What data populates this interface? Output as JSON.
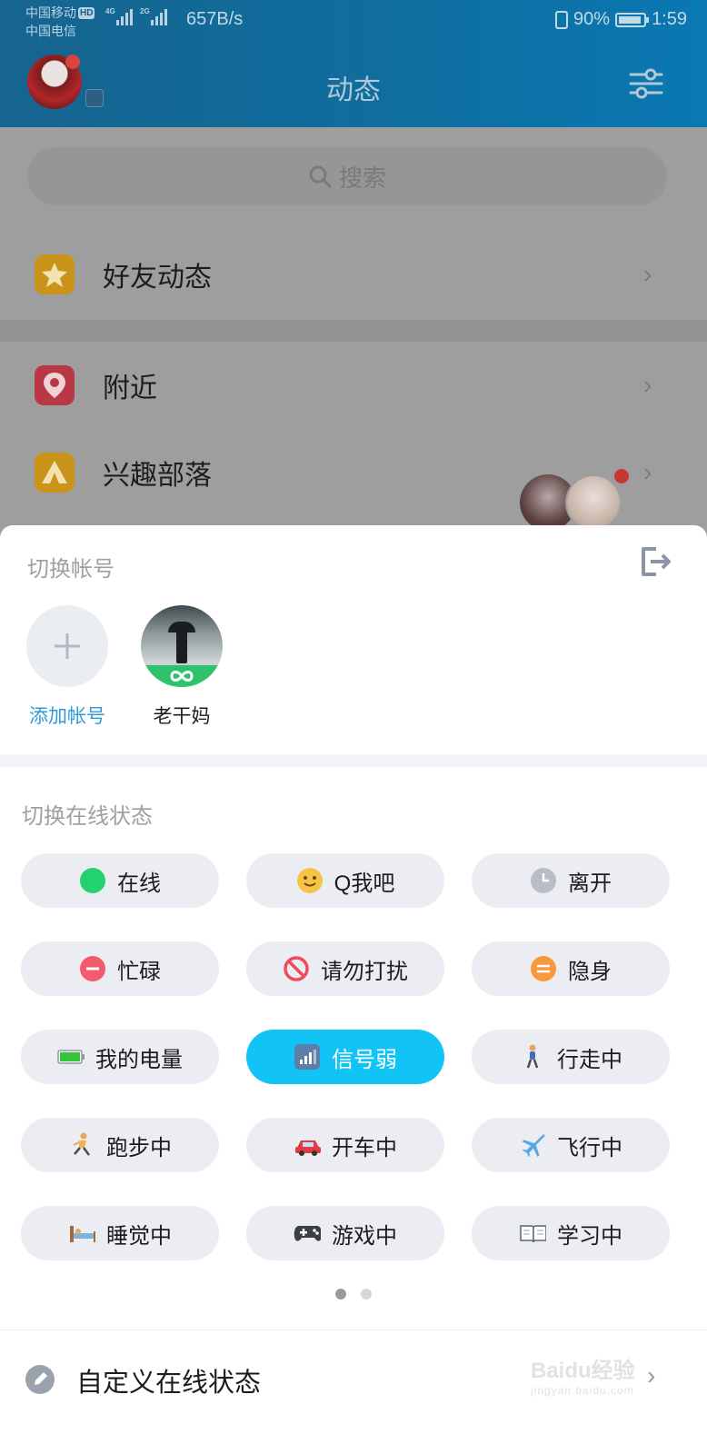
{
  "status_bar": {
    "carrier1": "中国移动",
    "carrier1_badge": "HD",
    "carrier2": "中国电信",
    "sim1_tag": "4G",
    "sim2_tag": "2G",
    "net_speed": "657B/s",
    "battery": "90%",
    "time": "1:59"
  },
  "header": {
    "title": "动态"
  },
  "search": {
    "placeholder": "搜索"
  },
  "feed_rows": [
    {
      "label": "好友动态",
      "icon": "star-icon",
      "color": "#d8a21a"
    },
    {
      "label": "附近",
      "icon": "location-pin-icon",
      "color": "#c9404d"
    },
    {
      "label": "兴趣部落",
      "icon": "tent-icon",
      "color": "#d8a21a"
    }
  ],
  "switch_account": {
    "title": "切换帐号",
    "accounts": [
      {
        "name": "添加帐号",
        "type": "add"
      },
      {
        "name": "老干妈",
        "type": "avatar"
      }
    ]
  },
  "online_status": {
    "title": "切换在线状态",
    "options": [
      {
        "label": "在线",
        "icon": "green-dot-icon",
        "active": false
      },
      {
        "label": "Q我吧",
        "icon": "smiley-icon",
        "active": false
      },
      {
        "label": "离开",
        "icon": "clock-icon",
        "active": false
      },
      {
        "label": "忙碌",
        "icon": "minus-circle-icon",
        "active": false
      },
      {
        "label": "请勿打扰",
        "icon": "no-entry-icon",
        "active": false
      },
      {
        "label": "隐身",
        "icon": "equals-circle-icon",
        "active": false
      },
      {
        "label": "我的电量",
        "icon": "battery-icon",
        "active": false
      },
      {
        "label": "信号弱",
        "icon": "signal-icon",
        "active": true
      },
      {
        "label": "行走中",
        "icon": "walking-icon",
        "active": false
      },
      {
        "label": "跑步中",
        "icon": "running-icon",
        "active": false
      },
      {
        "label": "开车中",
        "icon": "car-icon",
        "active": false
      },
      {
        "label": "飞行中",
        "icon": "airplane-icon",
        "active": false
      },
      {
        "label": "睡觉中",
        "icon": "bed-icon",
        "active": false
      },
      {
        "label": "游戏中",
        "icon": "gamepad-icon",
        "active": false
      },
      {
        "label": "学习中",
        "icon": "book-icon",
        "active": false
      }
    ],
    "page_count": 2,
    "current_page": 1
  },
  "custom_status": {
    "label": "自定义在线状态"
  },
  "watermark": {
    "text": "Baidu经验",
    "subtext": "jingyan.baidu.com"
  },
  "colors": {
    "accent": "#11c4f5",
    "link": "#2f9bd6",
    "pill_bg": "#ebedf2",
    "header_bg": "#0e6fa0"
  }
}
